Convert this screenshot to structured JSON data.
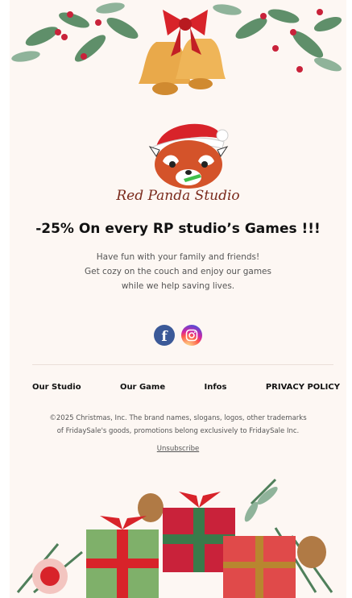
{
  "brand": {
    "name": "Red Panda Studio"
  },
  "headline": "-25% On every RP studio’s Games !!!",
  "body_lines": [
    "Have fun with your family and friends!",
    "Get cozy on the couch and enjoy our games",
    "while we help saving lives."
  ],
  "social": {
    "facebook_glyph": "f",
    "icons": [
      "facebook-icon",
      "instagram-icon"
    ]
  },
  "nav": [
    "Our Studio",
    "Our Game",
    "Infos",
    "PRIVACY POLICY"
  ],
  "legal_lines": [
    "©2025 Christmas, Inc. The brand names, slogans, logos, other trademarks",
    "of FridaySale's goods, promotions belong exclusively to FridaySale Inc."
  ],
  "unsubscribe": "Unsubscribe",
  "colors": {
    "card_bg": "#fdf7f3",
    "facebook": "#3b5998",
    "ribbon_red": "#d8232a",
    "bell_gold": "#e9a94a",
    "pine_green": "#4f7f5a"
  }
}
